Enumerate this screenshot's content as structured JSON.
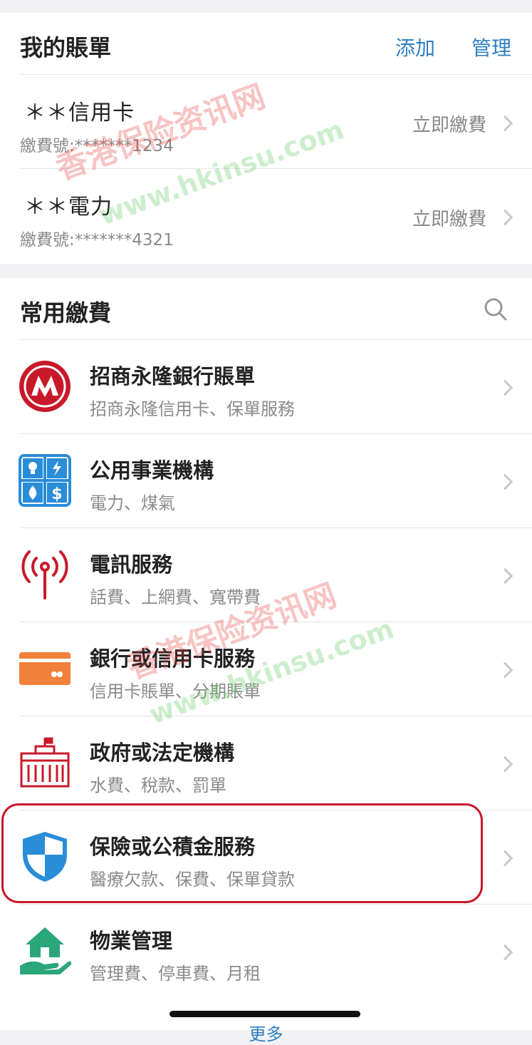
{
  "my_bills": {
    "title": "我的賬單",
    "add_label": "添加",
    "manage_label": "管理",
    "items": [
      {
        "name": "＊＊信用卡",
        "number": "繳費號:*******1234",
        "action": "立即繳費"
      },
      {
        "name": "＊＊電力",
        "number": "繳費號:*******4321",
        "action": "立即繳費"
      }
    ]
  },
  "common_payments": {
    "title": "常用繳費",
    "search_icon": "search-icon",
    "items": [
      {
        "title": "招商永隆銀行賬單",
        "subtitle": "招商永隆信用卡、保單服務",
        "icon": "cmb-wing-lung-logo"
      },
      {
        "title": "公用事業機構",
        "subtitle": "電力、煤氣",
        "icon": "utilities-icon"
      },
      {
        "title": "電訊服務",
        "subtitle": "話費、上網費、寬帶費",
        "icon": "antenna-icon"
      },
      {
        "title": "銀行或信用卡服務",
        "subtitle": "信用卡賬單、分期賬單",
        "icon": "credit-card-icon"
      },
      {
        "title": "政府或法定機構",
        "subtitle": "水費、稅款、罰單",
        "icon": "government-building-icon"
      },
      {
        "title": "保險或公積金服務",
        "subtitle": "醫療欠款、保費、保單貸款",
        "icon": "shield-icon",
        "highlighted": true
      },
      {
        "title": "物業管理",
        "subtitle": "管理費、停車費、月租",
        "icon": "house-hand-icon"
      }
    ],
    "more_label": "更多"
  },
  "watermark": {
    "line1": "香港保险资讯网",
    "line2": "www.hkinsu.com"
  },
  "colors": {
    "accent": "#2f7fc1",
    "highlight": "#c8192a",
    "cmb_red": "#c8192a",
    "card_orange": "#f0813a",
    "shield_blue": "#2a8dd8",
    "house_green": "#2aa67a"
  }
}
